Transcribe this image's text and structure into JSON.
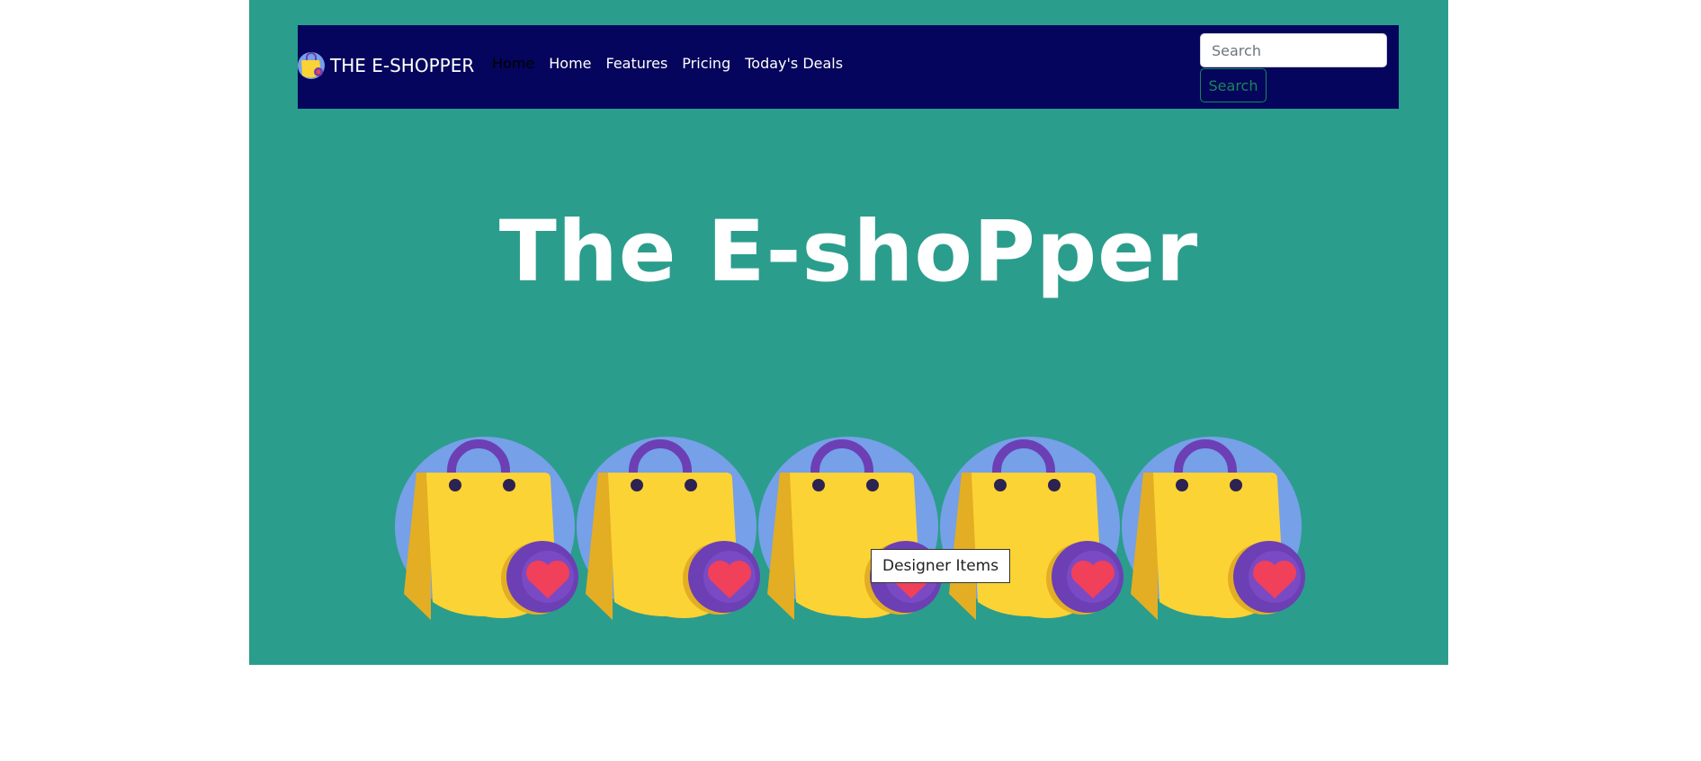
{
  "brand": {
    "name": "THE E-SHOPPER",
    "icon": "shopping-bag-icon"
  },
  "nav": {
    "links": [
      {
        "label": "Home",
        "active": true
      },
      {
        "label": "Home"
      },
      {
        "label": "Features"
      },
      {
        "label": "Pricing"
      },
      {
        "label": "Today's Deals"
      }
    ]
  },
  "search": {
    "placeholder": "Search",
    "button_label": "Search"
  },
  "hero": {
    "title": "The E-shoPper"
  },
  "products": [
    {
      "icon": "shopping-bag-heart-icon"
    },
    {
      "icon": "shopping-bag-heart-icon"
    },
    {
      "icon": "shopping-bag-heart-icon"
    },
    {
      "icon": "shopping-bag-heart-icon"
    },
    {
      "icon": "shopping-bag-heart-icon"
    }
  ],
  "tooltip": {
    "text": "Designer Items"
  },
  "colors": {
    "page_bg": "#2b9d8c",
    "navbar_bg": "#05055d",
    "search_accent": "#198754",
    "bag_yellow": "#fcd334",
    "bag_circle": "#76a0e8",
    "handle_purple": "#6c3fb5",
    "heart_red": "#f0405a"
  }
}
